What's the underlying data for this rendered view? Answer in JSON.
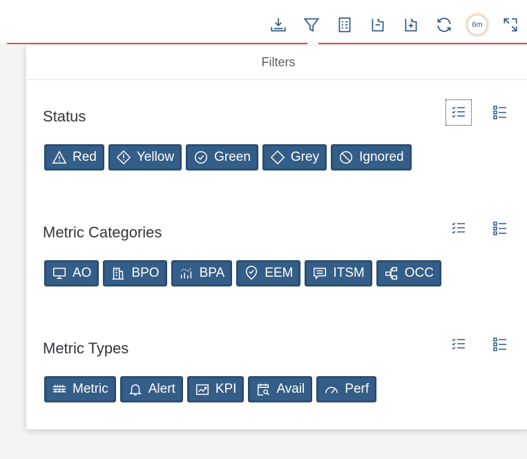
{
  "toolbar": {
    "items": [
      {
        "icon": "download-icon"
      },
      {
        "icon": "filter-icon"
      },
      {
        "icon": "list-detail-icon"
      },
      {
        "icon": "collapse-all-icon"
      },
      {
        "icon": "expand-all-icon"
      },
      {
        "icon": "refresh-icon"
      },
      {
        "icon": "timer-icon",
        "label": "6m"
      },
      {
        "icon": "fullscreen-icon"
      }
    ]
  },
  "filters": {
    "title": "Filters",
    "sections": [
      {
        "title": "Status",
        "chips": [
          {
            "label": "Red",
            "icon": "warning-icon"
          },
          {
            "label": "Yellow",
            "icon": "diamond-warning-icon"
          },
          {
            "label": "Green",
            "icon": "check-circle-icon"
          },
          {
            "label": "Grey",
            "icon": "diamond-icon"
          },
          {
            "label": "Ignored",
            "icon": "ban-icon"
          }
        ]
      },
      {
        "title": "Metric Categories",
        "chips": [
          {
            "label": "AO",
            "icon": "monitor-icon"
          },
          {
            "label": "BPO",
            "icon": "building-icon"
          },
          {
            "label": "BPA",
            "icon": "chart-dots-icon"
          },
          {
            "label": "EEM",
            "icon": "shield-check-icon"
          },
          {
            "label": "ITSM",
            "icon": "message-icon"
          },
          {
            "label": "OCC",
            "icon": "network-icon"
          }
        ]
      },
      {
        "title": "Metric Types",
        "chips": [
          {
            "label": "Metric",
            "icon": "gauge-bars-icon"
          },
          {
            "label": "Alert",
            "icon": "bell-icon"
          },
          {
            "label": "KPI",
            "icon": "kpi-chart-icon"
          },
          {
            "label": "Avail",
            "icon": "calendar-search-icon"
          },
          {
            "label": "Perf",
            "icon": "speedometer-icon"
          }
        ]
      }
    ]
  },
  "colors": {
    "chip_bg": "#345e87",
    "icon": "#2d5a86",
    "accent_line": "#d9534f"
  }
}
